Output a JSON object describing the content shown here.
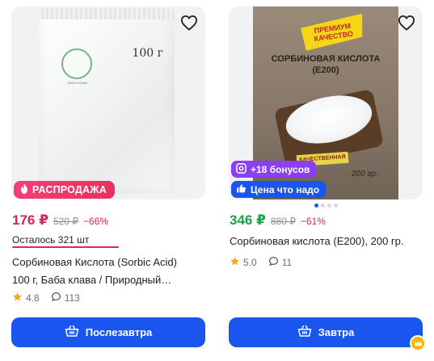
{
  "products": [
    {
      "price": "176 ₽",
      "old_price": "520 ₽",
      "discount": "−66%",
      "stock_text": "Осталось 321 шт",
      "badge_sale": "РАСПРОДАЖА",
      "title_line1": "Сорбиновая Кислота (Sorbic Acid)",
      "title_line2": "100 г, Баба клава / Природный…",
      "rating": "4.8",
      "reviews": "113",
      "button_label": "Послезавтра",
      "photo_text": {
        "weight": "100 г",
        "logo": "БАБА КЛАВА"
      }
    },
    {
      "price": "346 ₽",
      "old_price": "880 ₽",
      "discount": "−61%",
      "badge_bonus": "+18 бонусов",
      "badge_price": "Цена что надо",
      "title_line1": "Сорбиновая кислота (Е200), 200 гр.",
      "rating": "5.0",
      "reviews": "11",
      "button_label": "Завтра",
      "photo_text": {
        "premium_line1": "ПРЕМИУМ",
        "premium_line2": "КАЧЕСТВО",
        "name_line1": "СОРБИНОВАЯ КИСЛОТА",
        "name_line2": "(E200)",
        "quality": "КАЧЕСТВЕННАЯ",
        "weight": "200 гр."
      }
    }
  ],
  "colors": {
    "accent": "#1a55ee",
    "sale_pink": "#e8315f",
    "price_pink": "#d6245c",
    "price_green": "#16a34a",
    "bonus_purple": "#8b3ff2",
    "star": "#f5a524"
  }
}
